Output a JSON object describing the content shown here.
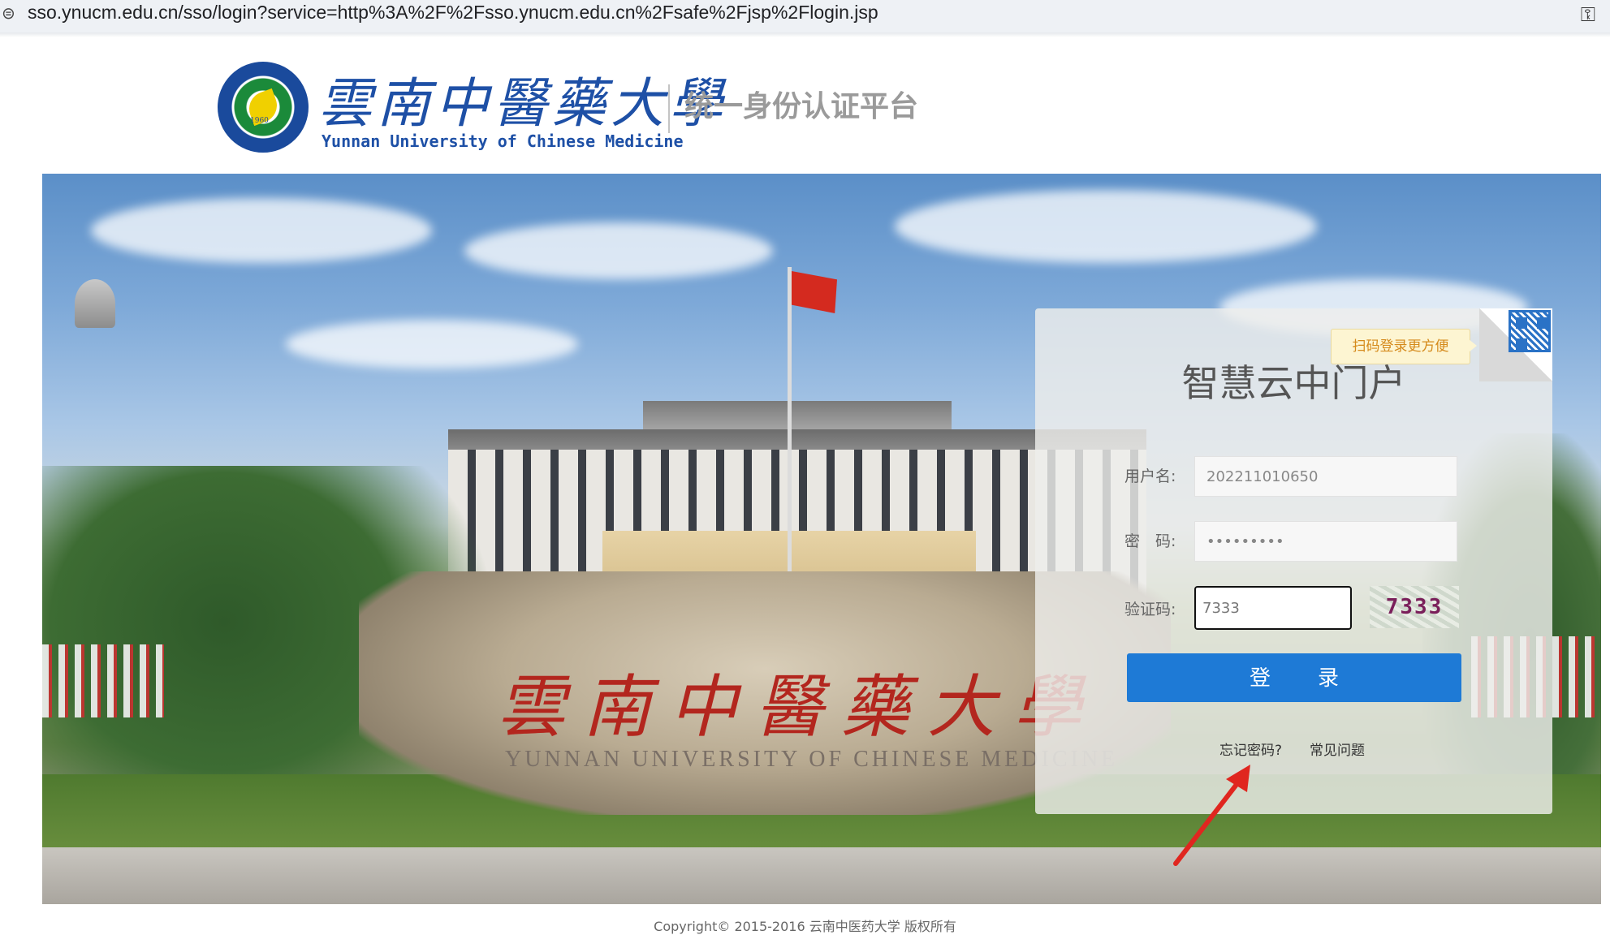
{
  "browser": {
    "url": "sso.ynucm.edu.cn/sso/login?service=http%3A%2F%2Fsso.ynucm.edu.cn%2Fsafe%2Fjsp%2Flogin.jsp",
    "icons": [
      "site-info-icon",
      "key-icon"
    ]
  },
  "header": {
    "university_cn": "雲南中醫藥大學",
    "university_en": "Yunnan University of Chinese Medicine",
    "emblem_year": "1960",
    "platform_title": "统一身份认证平台"
  },
  "banner": {
    "rock_inscription_cn": "雲南中醫藥大學",
    "rock_inscription_en": "YUNNAN UNIVERSITY OF CHINESE MEDICINE"
  },
  "login": {
    "qr_tip": "扫码登录更方便",
    "title": "智慧云中门户",
    "username_label": "用户名:",
    "username_value": "202211010650",
    "password_label": "密　码:",
    "password_value": "•••••••••",
    "captcha_label": "验证码:",
    "captcha_value": "7333",
    "captcha_image_text": "7333",
    "login_button": "登录",
    "forgot_password": "忘记密码?",
    "faq": "常见问题"
  },
  "footer": {
    "copyright": "Copyright© 2015-2016 云南中医药大学 版权所有"
  },
  "colors": {
    "brand_blue": "#1e50a6",
    "button_blue": "#1e7ad6",
    "annotation_red": "#e0261f"
  }
}
